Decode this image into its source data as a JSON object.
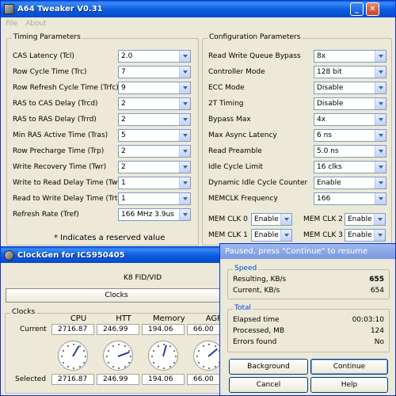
{
  "tweaker": {
    "title": "A64 Tweaker V0.31",
    "menu": [
      "File",
      "About"
    ],
    "timing_group": "Timing Parameters",
    "timing": [
      {
        "label": "CAS Latency (Tcl)",
        "value": "2.0"
      },
      {
        "label": "Row Cycle Time (Trc)",
        "value": "7"
      },
      {
        "label": "Row Refresh Cycle Time (Trfc)",
        "value": "9"
      },
      {
        "label": "RAS to CAS Delay (Trcd)",
        "value": "2"
      },
      {
        "label": "RAS to RAS Delay (Trrd)",
        "value": "2"
      },
      {
        "label": "Min RAS Active Time (Tras)",
        "value": "5"
      },
      {
        "label": "Row Precharge Time (Trp)",
        "value": "2"
      },
      {
        "label": "Write Recovery Time (Twr)",
        "value": "2"
      },
      {
        "label": "Write to Read Delay Time (Twtr)",
        "value": "1"
      },
      {
        "label": "Read to Write Delay Time (Trtw)",
        "value": "1"
      },
      {
        "label": "Refresh Rate (Tref)",
        "value": "166 MHz 3.9us"
      }
    ],
    "reserved_note": "* Indicates a reserved value",
    "config_group": "Configuration Parameters",
    "config": [
      {
        "label": "Read Write Queue Bypass",
        "value": "8x"
      },
      {
        "label": "Controller Mode",
        "value": "128 bit"
      },
      {
        "label": "ECC Mode",
        "value": "Disable"
      },
      {
        "label": "2T Timing",
        "value": "Disable"
      },
      {
        "label": "Bypass Max",
        "value": "4x"
      },
      {
        "label": "Max Async Latency",
        "value": "6 ns"
      },
      {
        "label": "Read Preamble",
        "value": "5.0 ns"
      },
      {
        "label": "Idle Cycle Limit",
        "value": "16 clks"
      },
      {
        "label": "Dynamic Idle Cycle Counter",
        "value": "Enable"
      },
      {
        "label": "MEMCLK Frequency",
        "value": "166"
      }
    ],
    "memclk": [
      {
        "label": "MEM CLK 0",
        "value": "Enable"
      },
      {
        "label": "MEM CLK 2",
        "value": "Enable"
      },
      {
        "label": "MEM CLK 1",
        "value": "Enable"
      },
      {
        "label": "MEM CLK 3",
        "value": "Enable"
      }
    ]
  },
  "clockgen": {
    "title": "ClockGen for ICS950405",
    "chip_label": "K8 FID/VID",
    "clocks_button": "Clocks",
    "clocks_group": "Clocks",
    "columns": [
      "CPU",
      "HTT",
      "Memory",
      "AGP"
    ],
    "current_label": "Current",
    "current": [
      "2716.87",
      "246.99",
      "194.06",
      "66.00"
    ],
    "selected_label": "Selected",
    "selected": [
      "2716.87",
      "246.99",
      "194.06",
      "66.00"
    ]
  },
  "paused": {
    "title": "Paused, press \"Continue\" to resume",
    "speed_group": "Speed",
    "resulting_label": "Resulting, KB/s",
    "resulting_value": "655",
    "current_label": "Current, KB/s",
    "current_value": "654",
    "total_group": "Total",
    "elapsed_label": "Elapsed time",
    "elapsed_value": "00:03:10",
    "processed_label": "Processed, MB",
    "processed_value": "124",
    "errors_label": "Errors found",
    "errors_value": "No",
    "background_button": "Background",
    "continue_button": "Continue",
    "cancel_button": "Cancel",
    "help_button": "Help"
  }
}
